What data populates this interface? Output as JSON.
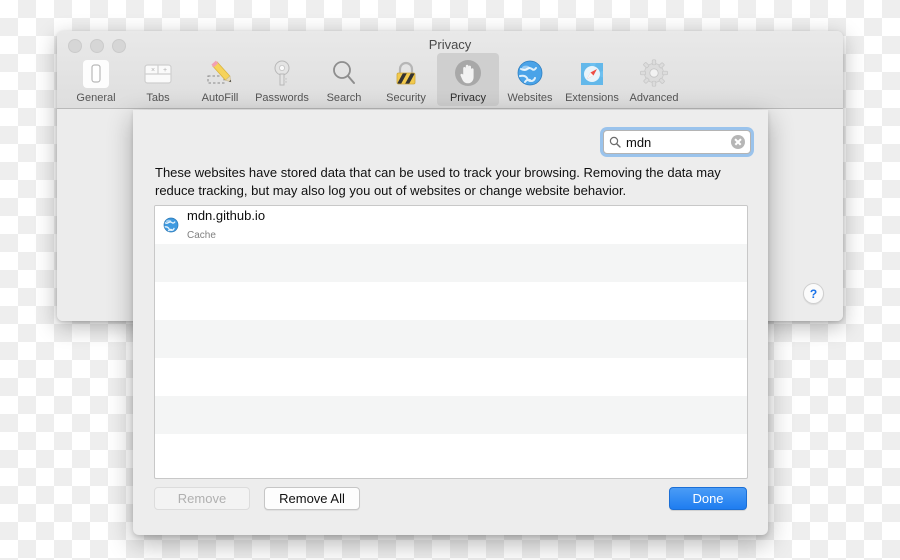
{
  "window": {
    "title": "Privacy",
    "traffic_lights": [
      "close",
      "minimize",
      "zoom"
    ]
  },
  "toolbar": {
    "items": [
      {
        "label": "General",
        "icon": "general-icon",
        "selected": false
      },
      {
        "label": "Tabs",
        "icon": "tabs-icon",
        "selected": false
      },
      {
        "label": "AutoFill",
        "icon": "autofill-icon",
        "selected": false
      },
      {
        "label": "Passwords",
        "icon": "passwords-icon",
        "selected": false
      },
      {
        "label": "Search",
        "icon": "search-icon",
        "selected": false
      },
      {
        "label": "Security",
        "icon": "security-icon",
        "selected": false
      },
      {
        "label": "Privacy",
        "icon": "privacy-icon",
        "selected": true
      },
      {
        "label": "Websites",
        "icon": "websites-icon",
        "selected": false
      },
      {
        "label": "Extensions",
        "icon": "extensions-icon",
        "selected": false
      },
      {
        "label": "Advanced",
        "icon": "advanced-icon",
        "selected": false
      }
    ]
  },
  "sheet": {
    "search": {
      "value": "mdn",
      "placeholder": "Search",
      "icon": "magnifier-icon",
      "clear_icon": "clear-circle-icon"
    },
    "description": "These websites have stored data that can be used to track your browsing. Removing the data may reduce tracking, but may also log you out of websites or change website behavior.",
    "list": {
      "rows": [
        {
          "site": "mdn.github.io",
          "detail": "Cache",
          "icon": "globe-icon"
        }
      ],
      "empty_row_count": 6
    },
    "buttons": {
      "remove": "Remove",
      "remove_all": "Remove All",
      "done": "Done"
    },
    "remove_enabled": false
  },
  "help": {
    "label": "?"
  },
  "colors": {
    "accent_blue": "#1f7df0",
    "focus_ring": "#56a0eb",
    "help_blue": "#1a72e8",
    "sheet_bg": "#ededed",
    "window_bg": "#ececec",
    "stripe": "#f4f5f5"
  }
}
